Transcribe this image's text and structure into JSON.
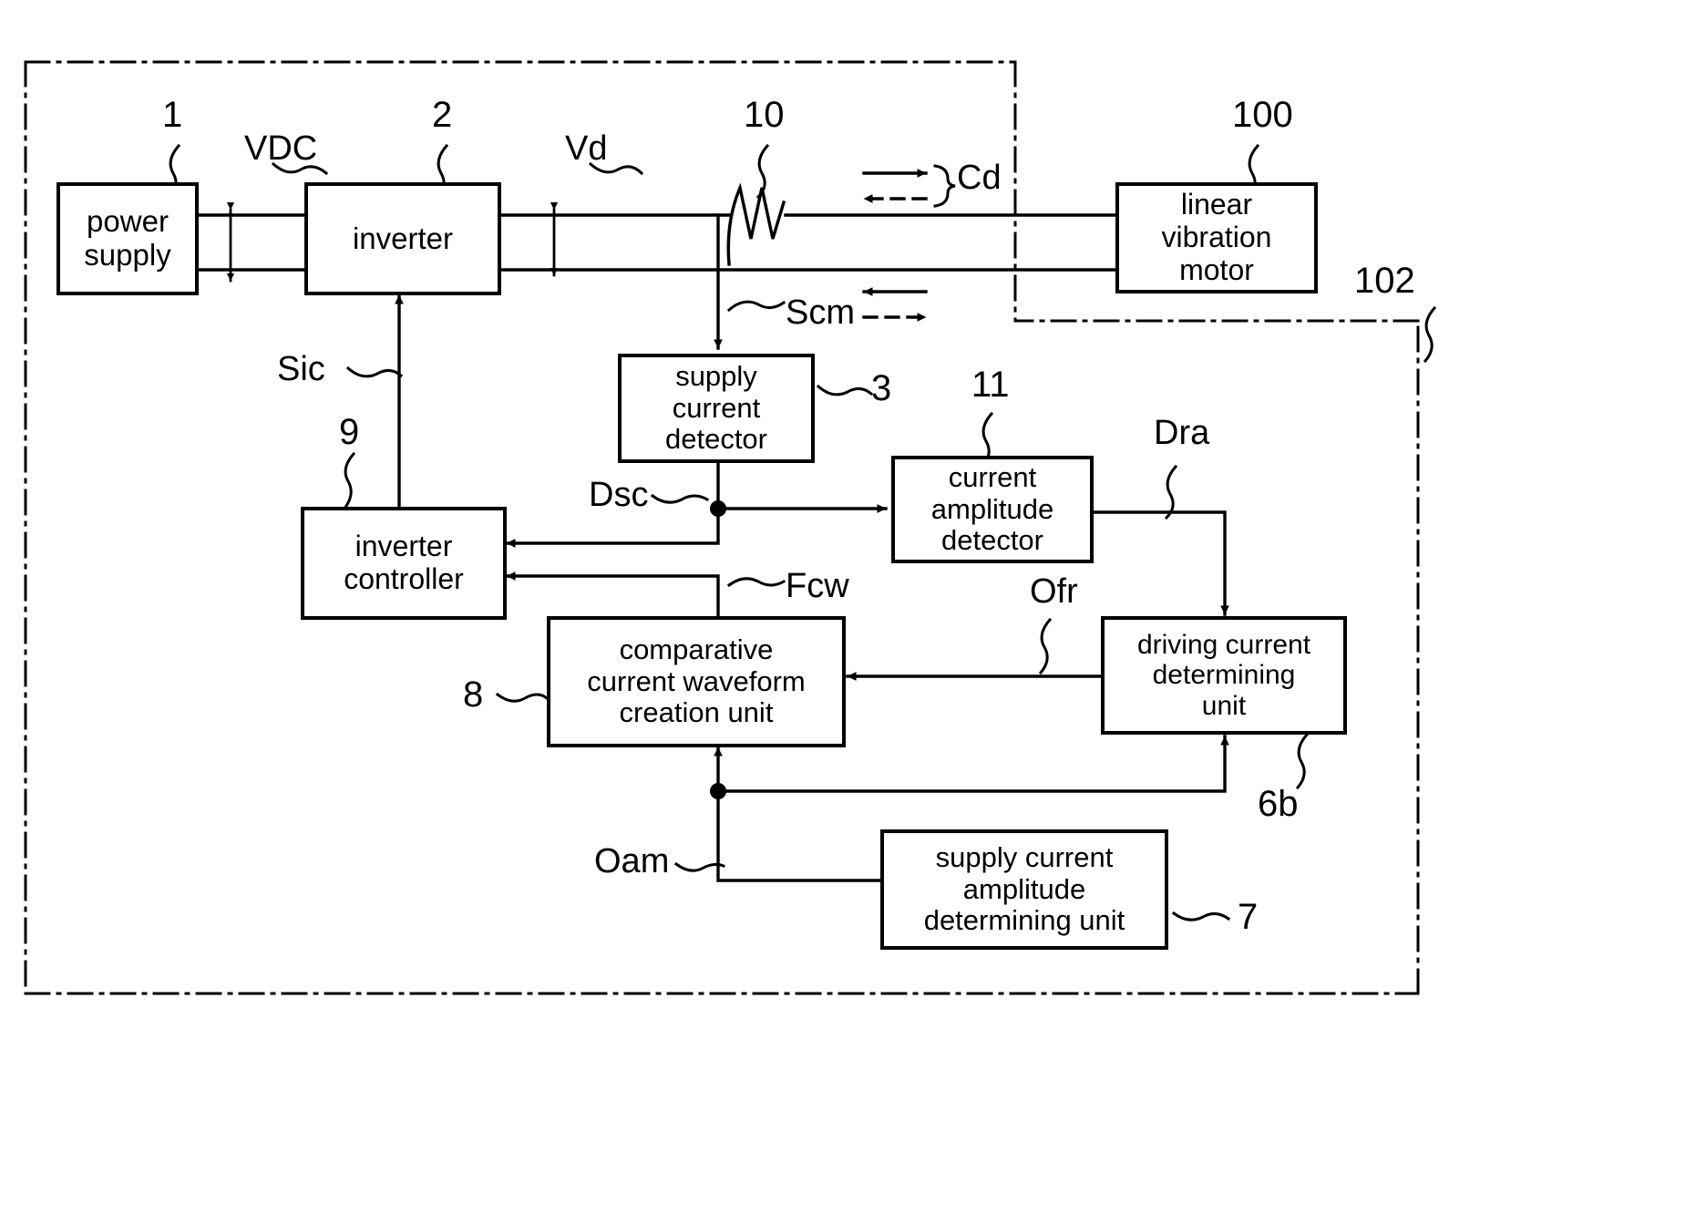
{
  "diagram": {
    "title_absent": true,
    "outer_boundary_style": "dash-dot",
    "blocks": [
      {
        "id": "power_supply",
        "label": "power\nsupply",
        "ref": "1"
      },
      {
        "id": "inverter",
        "label": "inverter",
        "ref": "2"
      },
      {
        "id": "linear_vibration_motor",
        "label": "linear\nvibration\nmotor",
        "ref": "100"
      },
      {
        "id": "supply_current_detector",
        "label": "supply\ncurrent\ndetector",
        "ref": "3"
      },
      {
        "id": "current_amplitude_detector",
        "label": "current\namplitude\ndetector",
        "ref": "11"
      },
      {
        "id": "driving_current_determining_unit",
        "label": "driving current\ndetermining\nunit",
        "ref": "6b"
      },
      {
        "id": "inverter_controller",
        "label": "inverter\ncontroller",
        "ref": "9"
      },
      {
        "id": "comparative_current_waveform_creation_unit",
        "label": "comparative\ncurrent waveform\ncreation unit",
        "ref": "8"
      },
      {
        "id": "supply_current_amplitude_determining_unit",
        "label": "supply current\namplitude\ndetermining unit",
        "ref": "7"
      }
    ],
    "block_text": {
      "power_supply_line1": "power",
      "power_supply_line2": "supply",
      "inverter": "inverter",
      "motor_line1": "linear",
      "motor_line2": "vibration",
      "motor_line3": "motor",
      "scd_line1": "supply",
      "scd_line2": "current",
      "scd_line3": "detector",
      "cad_line1": "current",
      "cad_line2": "amplitude",
      "cad_line3": "detector",
      "dcdu_line1": "driving current",
      "dcdu_line2": "determining",
      "dcdu_line3": "unit",
      "ic_line1": "inverter",
      "ic_line2": "controller",
      "ccwcu_line1": "comparative",
      "ccwcu_line2": "current waveform",
      "ccwcu_line3": "creation unit",
      "scadu_line1": "supply current",
      "scadu_line2": "amplitude",
      "scadu_line3": "determining unit"
    },
    "reference_numerals": {
      "n1": "1",
      "n2": "2",
      "n10": "10",
      "n100": "100",
      "n102": "102",
      "n3": "3",
      "n11": "11",
      "n9": "9",
      "n8": "8",
      "n6b": "6b",
      "n7": "7"
    },
    "signal_labels": {
      "vdc": "VDC",
      "vd": "Vd",
      "cd": "Cd",
      "scm": "Scm",
      "sic": "Sic",
      "dsc": "Dsc",
      "dra": "Dra",
      "ofr": "Ofr",
      "fcw": "Fcw",
      "oam": "Oam"
    },
    "colors": {
      "line": "#000000",
      "background": "#ffffff"
    }
  }
}
